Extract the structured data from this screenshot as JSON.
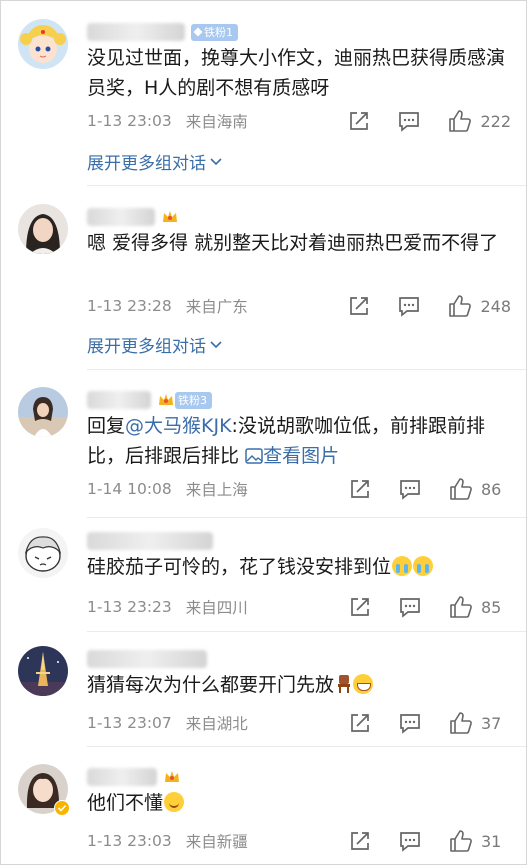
{
  "comments": [
    {
      "badge": "铁粉1",
      "text": "没见过世面，挽尊大小作文，迪丽热巴获得质感演员奖，H人的剧不想有质感呀",
      "time": "1-13 23:03",
      "location": "来自海南",
      "likes": "222",
      "expand_label": "展开更多组对话"
    },
    {
      "text": "嗯 爱得多得 就别整天比对着迪丽热巴爱而不得了",
      "time": "1-13 23:28",
      "location": "来自广东",
      "likes": "248",
      "expand_label": "展开更多组对话"
    },
    {
      "badge": "铁粉3",
      "reply_prefix": "回复",
      "reply_mention": "@大马猴KJK",
      "text_after_mention": ":没说胡歌咖位低，前排跟前排比，后排跟后排比",
      "view_image": "查看图片",
      "time": "1-14 10:08",
      "location": "来自上海",
      "likes": "86"
    },
    {
      "text": "硅胶茄子可怜的，花了钱没安排到位",
      "time": "1-13 23:23",
      "location": "来自四川",
      "likes": "85"
    },
    {
      "text": "猜猜每次为什么都要开门先放",
      "time": "1-13 23:07",
      "location": "来自湖北",
      "likes": "37"
    },
    {
      "text": "他们不懂",
      "time": "1-13 23:03",
      "location": "来自新疆",
      "likes": "31"
    }
  ],
  "colors": {
    "link": "#3b6ea8",
    "meta": "#8c8c8c",
    "badge": "#a8c8f0"
  }
}
